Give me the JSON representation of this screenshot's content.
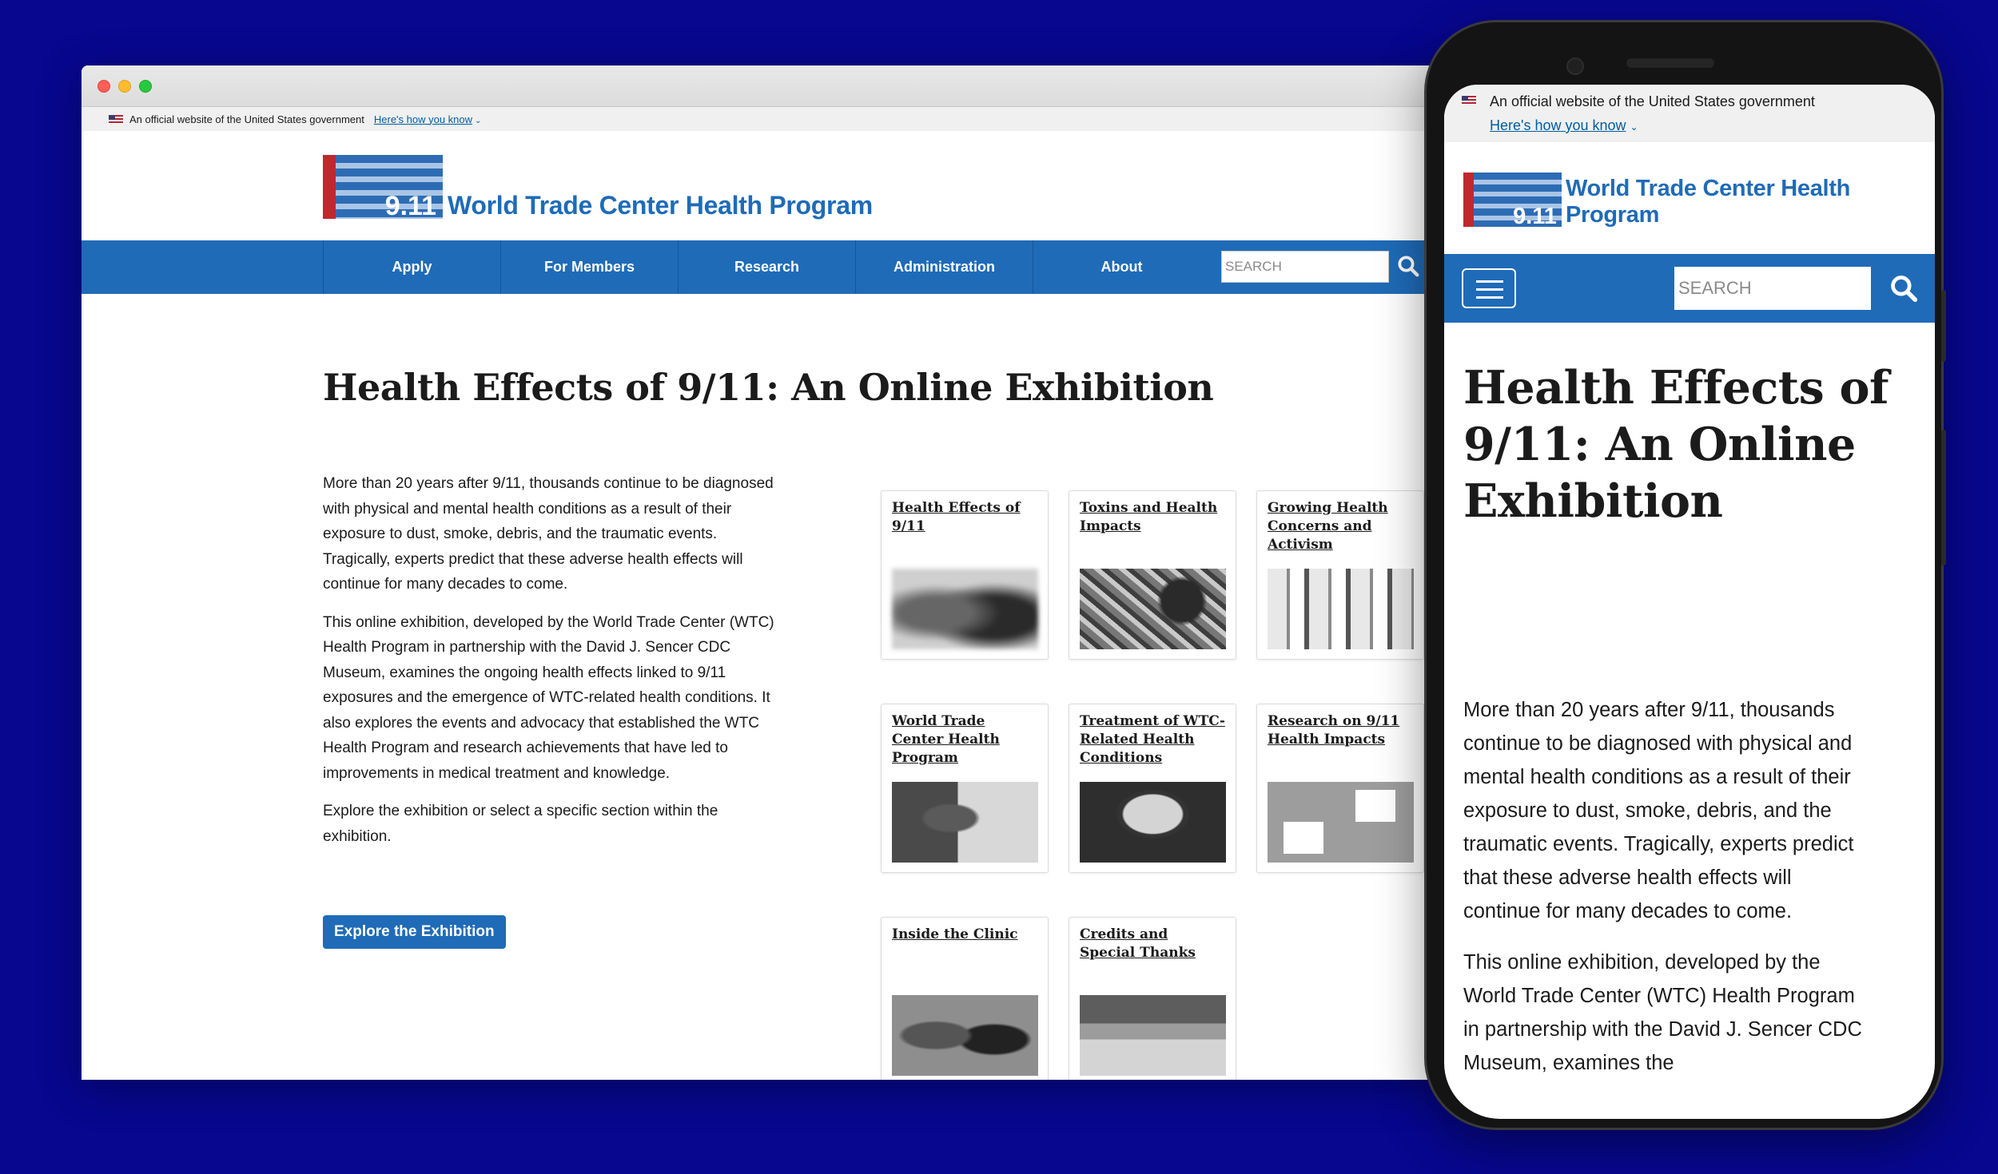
{
  "colors": {
    "page_background": "#07078f",
    "brand_blue": "#1f6bb8",
    "link_blue": "#005ea2",
    "logo_red": "#c0282e"
  },
  "gov_banner": {
    "text": "An official website of the United States government",
    "link": "Here's how you know"
  },
  "logo": {
    "mark": "9.11",
    "name": "World Trade Center Health Program"
  },
  "nav": {
    "items": [
      "Apply",
      "For Members",
      "Research",
      "Administration",
      "About"
    ],
    "search_placeholder": "SEARCH",
    "search_icon": "search-icon"
  },
  "page": {
    "title": "Health Effects of 9/11: An Online Exhibition",
    "paragraphs": [
      "More than 20 years after 9/11, thousands continue to be diagnosed with physical and mental health conditions as a result of their exposure to dust, smoke, debris, and the traumatic events. Tragically, experts predict that these adverse health effects will continue for many decades to come.",
      "This online exhibition, developed by the World Trade Center (WTC) Health Program in partnership with the David J. Sencer CDC Museum, examines the ongoing health effects linked to 9/11 exposures and the emergence of WTC-related health conditions. It also explores the events and advocacy that established the WTC Health Program and research achievements that have led to improvements in medical treatment and knowledge.",
      "Explore the exhibition or select a specific section within the exhibition."
    ],
    "cta": "Explore the Exhibition"
  },
  "cards": [
    {
      "title": "Health Effects of 9/11"
    },
    {
      "title": "Toxins and Health Impacts"
    },
    {
      "title": "Growing Health Concerns and Activism"
    },
    {
      "title": "World Trade Center Health Program"
    },
    {
      "title": "Treatment of WTC-Related Health Conditions"
    },
    {
      "title": "Research on 9/11 Health Impacts"
    },
    {
      "title": "Inside the Clinic"
    },
    {
      "title": "Credits and Special Thanks"
    }
  ],
  "mobile": {
    "title": "Health Effects of 9/11: An Online Exhibition",
    "paragraphs": [
      "More than 20 years after 9/11, thousands continue to be diagnosed with physical and mental health conditions as a result of their exposure to dust, smoke, debris, and the traumatic events. Tragically, experts predict that these adverse health effects will continue for many decades to come.",
      "This online exhibition, developed by the World Trade Center (WTC) Health Program in partnership with the David J. Sencer CDC Museum, examines the"
    ]
  }
}
